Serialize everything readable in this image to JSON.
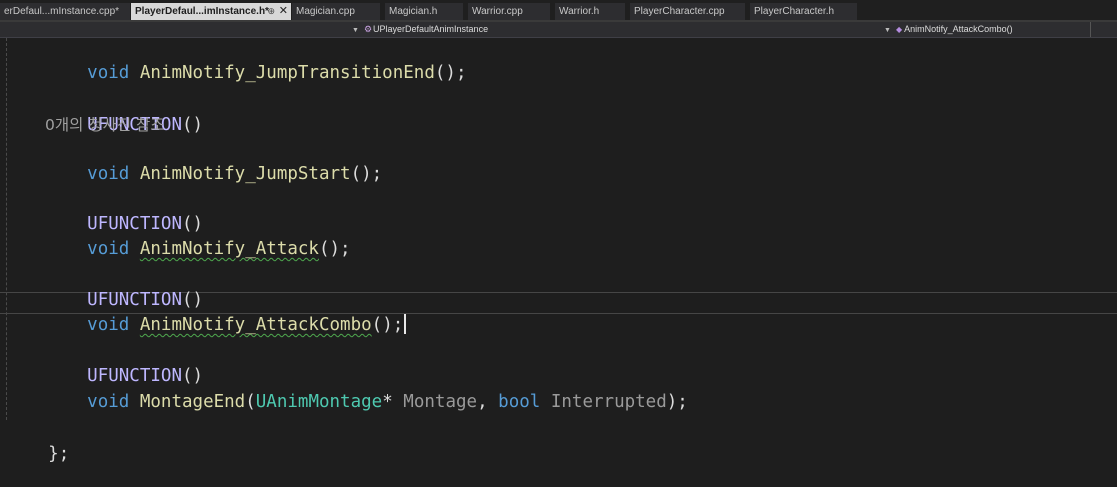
{
  "tabs": [
    {
      "label": "erDefaul...mInstance.cpp*",
      "active": false
    },
    {
      "label": "PlayerDefaul...imInstance.h*",
      "active": true,
      "pin": "⊕",
      "close": "✕"
    },
    {
      "label": "Magician.cpp",
      "active": false
    },
    {
      "label": "Magician.h",
      "active": false
    },
    {
      "label": "Warrior.cpp",
      "active": false
    },
    {
      "label": "Warrior.h",
      "active": false
    },
    {
      "label": "PlayerCharacter.cpp",
      "active": false
    },
    {
      "label": "PlayerCharacter.h",
      "active": false
    }
  ],
  "nav": {
    "class_scope": "UPlayerDefaultAnimInstance",
    "member_scope": "AnimNotify_AttackCombo()"
  },
  "code": {
    "kw_void": "void",
    "kw_bool": "bool",
    "macro": "UFUNCTION",
    "empty_parens": "()",
    "call_end": "();",
    "fn_jump_transition_end": "AnimNotify_JumpTransitionEnd",
    "codelens_hint": "0개의 청사진 참조",
    "fn_jump_start": "AnimNotify_JumpStart",
    "fn_attack": "AnimNotify_Attack",
    "fn_attack_combo": "AnimNotify_AttackCombo",
    "fn_montage_end": "MontageEnd",
    "type_anim_montage": "UAnimMontage",
    "pointer_star": "*",
    "param_montage": "Montage",
    "comma": ",",
    "param_interrupted": "Interrupted",
    "open_paren": "(",
    "close_semicolon": ");",
    "closing_brace": "};"
  },
  "colors": {
    "editor_background": "#1e1e1e",
    "keyword": "#569cd6",
    "macro": "#beb7ff",
    "function": "#dcdcaa",
    "type": "#4ec9b0",
    "squiggle": "#4fa94f"
  }
}
